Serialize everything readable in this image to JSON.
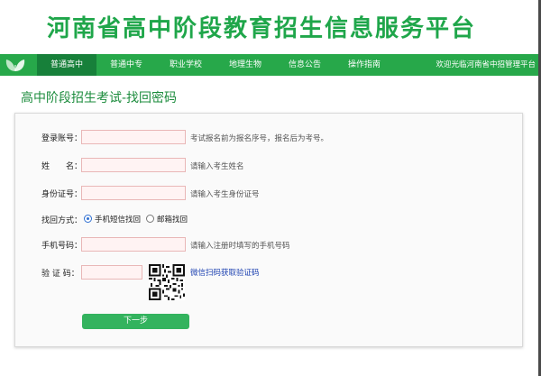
{
  "banner": {
    "title": "河南省高中阶段教育招生信息服务平台"
  },
  "nav": {
    "items": [
      {
        "label": "普通高中"
      },
      {
        "label": "普通中专"
      },
      {
        "label": "职业学校"
      },
      {
        "label": "地理生物"
      },
      {
        "label": "信息公告"
      },
      {
        "label": "操作指南"
      }
    ],
    "active": "普通高中",
    "welcome": "欢迎光临河南省中招管理平台"
  },
  "page": {
    "heading": "高中阶段招生考试-找回密码"
  },
  "form": {
    "account": {
      "label": "登录账号：",
      "value": "",
      "hint": "考试报名前为报名序号，报名后为考号。"
    },
    "name": {
      "label": "姓　　名：",
      "value": "",
      "hint": "请输入考生姓名"
    },
    "id_number": {
      "label": "身份证号：",
      "value": "",
      "hint": "请输入考生身份证号"
    },
    "recovery_method": {
      "label": "找回方式：",
      "options": [
        {
          "label": "手机短信找回",
          "checked": true
        },
        {
          "label": "邮箱找回",
          "checked": false
        }
      ]
    },
    "phone": {
      "label": "手机号码：",
      "value": "",
      "hint": "请输入注册时填写的手机号码"
    },
    "captcha": {
      "label": "验 证 码：",
      "value": "",
      "qr_icon": "qr-code-icon",
      "link_text": "微信扫码获取验证码"
    },
    "submit_label": "下一步"
  },
  "colors": {
    "brand_green": "#27a84a",
    "nav_active": "#17803a",
    "heading_green": "#1c8c3d",
    "button_green": "#33b35e",
    "link_blue": "#1a3fb0",
    "input_bg": "#fff3f3",
    "input_border": "#e9b7b7"
  }
}
